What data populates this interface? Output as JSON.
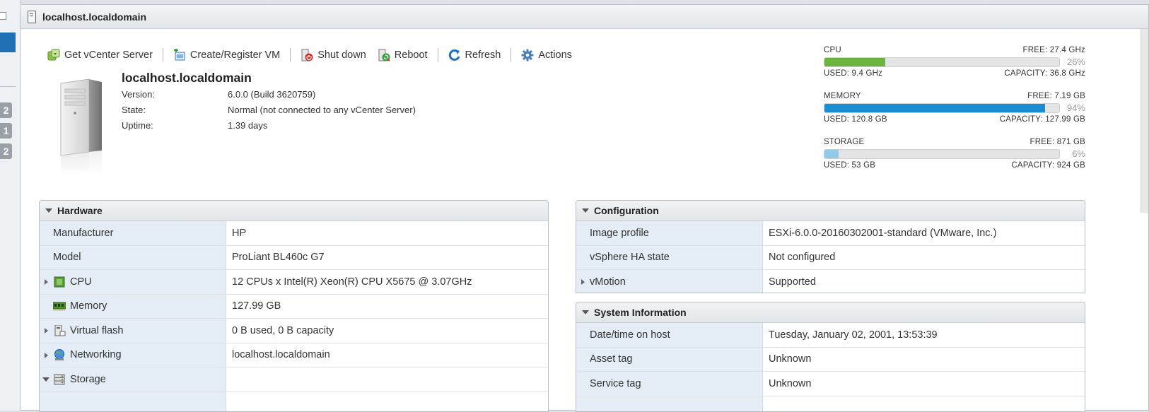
{
  "left_strip": {
    "badges": [
      "2",
      "1",
      "2"
    ]
  },
  "window": {
    "title": "localhost.localdomain"
  },
  "toolbar": {
    "buttons": [
      {
        "label": "Get vCenter Server",
        "icon": "vcenter-icon"
      },
      {
        "label": "Create/Register VM",
        "icon": "create-vm-icon"
      },
      {
        "label": "Shut down",
        "icon": "shutdown-icon"
      },
      {
        "label": "Reboot",
        "icon": "reboot-icon"
      },
      {
        "label": "Refresh",
        "icon": "refresh-icon"
      },
      {
        "label": "Actions",
        "icon": "gear-icon"
      }
    ]
  },
  "host": {
    "name": "localhost.localdomain",
    "version_label": "Version:",
    "version": "6.0.0 (Build 3620759)",
    "state_label": "State:",
    "state": "Normal (not connected to any vCenter Server)",
    "uptime_label": "Uptime:",
    "uptime": "1.39 days"
  },
  "resources": {
    "cpu": {
      "name": "CPU",
      "free": "FREE: 27.4 GHz",
      "used": "USED: 9.4 GHz",
      "capacity": "CAPACITY: 36.8 GHz",
      "percent_label": "26%",
      "percent": 26,
      "color": "#6db33f"
    },
    "memory": {
      "name": "MEMORY",
      "free": "FREE: 7.19 GB",
      "used": "USED: 120.8 GB",
      "capacity": "CAPACITY: 127.99 GB",
      "percent_label": "94%",
      "percent": 94,
      "color": "#1b8dd1"
    },
    "storage": {
      "name": "STORAGE",
      "free": "FREE: 871 GB",
      "used": "USED: 53 GB",
      "capacity": "CAPACITY: 924 GB",
      "percent_label": "6%",
      "percent": 6,
      "color": "#8fcbe8"
    }
  },
  "hardware": {
    "title": "Hardware",
    "rows": [
      {
        "key": "Manufacturer",
        "value": "HP"
      },
      {
        "key": "Model",
        "value": "ProLiant BL460c G7"
      },
      {
        "key": "CPU",
        "value": "12 CPUs x Intel(R) Xeon(R) CPU X5675 @ 3.07GHz"
      },
      {
        "key": "Memory",
        "value": "127.99 GB"
      },
      {
        "key": "Virtual flash",
        "value": "0 B used, 0 B capacity"
      },
      {
        "key": "Networking",
        "value": "localhost.localdomain"
      },
      {
        "key": "Storage",
        "value": ""
      }
    ]
  },
  "configuration": {
    "title": "Configuration",
    "rows": [
      {
        "key": "Image profile",
        "value": "ESXi-6.0.0-20160302001-standard (VMware, Inc.)"
      },
      {
        "key": "vSphere HA state",
        "value": "Not configured"
      },
      {
        "key": "vMotion",
        "value": "Supported"
      }
    ]
  },
  "system_information": {
    "title": "System Information",
    "rows": [
      {
        "key": "Date/time on host",
        "value": "Tuesday, January 02, 2001, 13:53:39"
      },
      {
        "key": "Asset tag",
        "value": "Unknown"
      },
      {
        "key": "Service tag",
        "value": "Unknown"
      }
    ]
  }
}
